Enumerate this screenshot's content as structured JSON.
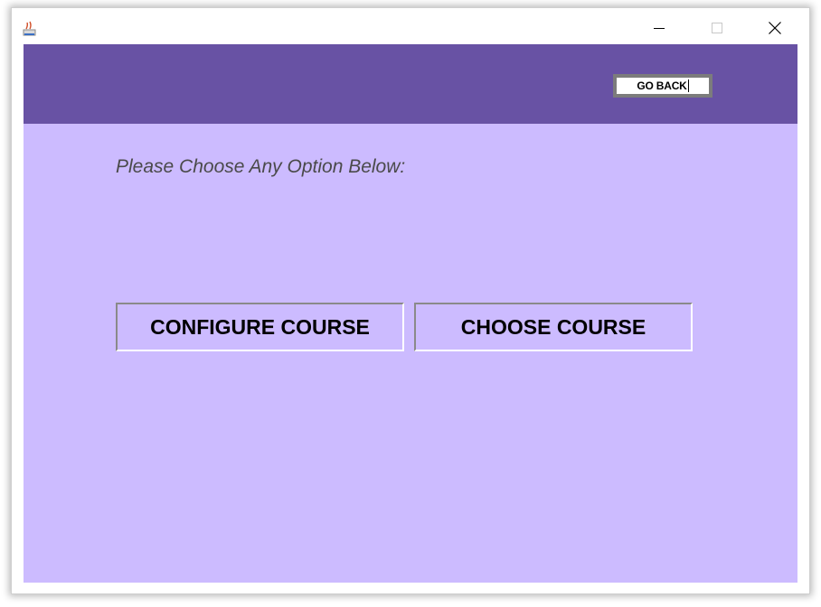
{
  "window": {
    "icon": "java-cup-icon",
    "controls": {
      "minimize": "minimize-icon",
      "maximize": "maximize-icon",
      "close": "close-icon"
    }
  },
  "header": {
    "go_back_label": "GO BACK"
  },
  "main": {
    "prompt": "Please Choose Any Option Below:",
    "configure_label": "CONFIGURE COURSE",
    "choose_label": "CHOOSE COURSE"
  },
  "colors": {
    "header_band": "#6852a4",
    "background": "#ccbbff",
    "prompt_text": "#4a4a4a"
  }
}
